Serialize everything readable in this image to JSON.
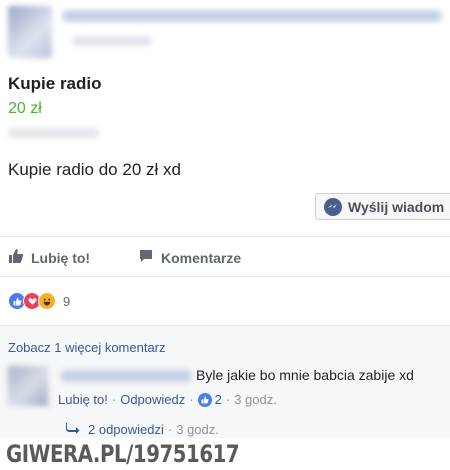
{
  "post": {
    "title": "Kupie radio",
    "price": "20 zł",
    "description": "Kupie radio do 20 zł xd",
    "message_button": "Wyślij wiadom",
    "like_label": "Lubię to!",
    "comment_label": "Komentarze",
    "reaction_count": "9"
  },
  "comments": {
    "more_link": "Zobacz 1 więcej komentarz",
    "item": {
      "text": "Byle jakie bo mnie babcia zabije xd",
      "like_link": "Lubię to!",
      "reply_link": "Odpowiedz",
      "like_count": "2",
      "time": "3 godz."
    },
    "replies_link": "2 odpowiedzi",
    "replies_sep": "·",
    "replies_time": "3 godz."
  },
  "watermark": "GIWERA.PL/19751617",
  "colors": {
    "price": "#42b72a",
    "link": "#385898",
    "like_reaction": "#4a7df0",
    "love_reaction": "#f33e58",
    "haha_reaction": "#f7b125"
  },
  "icons": [
    "messenger-icon",
    "thumbs-up-icon",
    "comment-icon",
    "reply-arrow-icon"
  ]
}
